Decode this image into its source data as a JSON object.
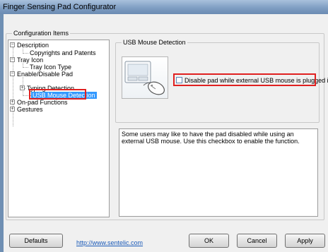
{
  "window": {
    "title": "Finger Sensing Pad Configurator"
  },
  "config_group": {
    "label": "Configuration Items"
  },
  "tree": {
    "items": [
      {
        "label": "Description"
      },
      {
        "label": "Copyrights and Patents"
      },
      {
        "label": "Tray Icon"
      },
      {
        "label": "Tray Icon Type"
      },
      {
        "label": "Enable/Disable Pad"
      },
      {
        "label": "Typing Detection"
      },
      {
        "label": "USB Mouse Detection"
      },
      {
        "label": "On-pad Functions"
      },
      {
        "label": "Gestures"
      }
    ]
  },
  "usb_group": {
    "label": "USB Mouse Detection",
    "checkbox_label": "Disable pad while external USB mouse is plugged in",
    "checked": false
  },
  "description": {
    "text": "Some users may like to have the pad disabled while using an external USB mouse. Use this checkbox to enable the function."
  },
  "footer": {
    "defaults_label": "Defaults",
    "link_text": "http://www.sentelic.com",
    "ok_label": "OK",
    "cancel_label": "Cancel",
    "apply_label": "Apply"
  },
  "colors": {
    "title_bar": "#7f9ec3",
    "selection": "#3399ff",
    "highlight_box": "#e02020",
    "link": "#1a5ab8"
  }
}
